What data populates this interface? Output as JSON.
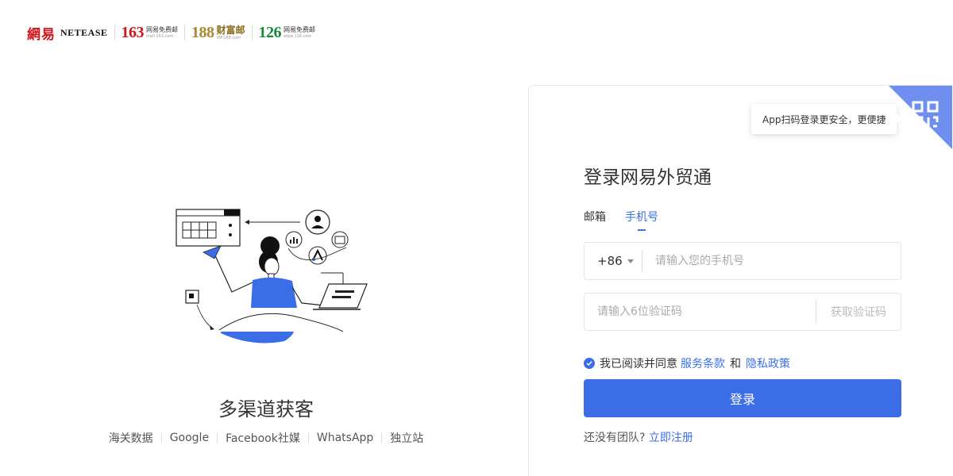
{
  "header": {
    "netease_cn": "網易",
    "netease_en": "NETEASE",
    "brands": [
      {
        "num": "163",
        "name": "网易免费邮",
        "domain": "mail.163.com"
      },
      {
        "num": "188",
        "name": "财富邮",
        "domain": "VIP.188.com"
      },
      {
        "num": "126",
        "name": "网易免费邮",
        "domain": "www.126.com"
      }
    ]
  },
  "promo": {
    "title": "多渠道获客",
    "tags": [
      "海关数据",
      "Google",
      "Facebook社媒",
      "WhatsApp",
      "独立站"
    ]
  },
  "login": {
    "qr_tooltip": "App扫码登录更安全，更便捷",
    "title": "登录网易外贸通",
    "tabs": [
      {
        "label": "邮箱",
        "active": false
      },
      {
        "label": "手机号",
        "active": true
      }
    ],
    "country_code": "+86",
    "phone_placeholder": "请输入您的手机号",
    "code_placeholder": "请输入6位验证码",
    "get_code_label": "获取验证码",
    "agree_prefix": "我已阅读并同意",
    "terms_link": "服务条款",
    "and_text": "和",
    "privacy_link": "隐私政策",
    "submit_label": "登录",
    "no_team_text": "还没有团队?",
    "register_link": "立即注册"
  },
  "colors": {
    "accent": "#3b6ee6",
    "netease_red": "#d0161c",
    "brand_188": "#a8892f",
    "brand_126": "#168a3a"
  }
}
